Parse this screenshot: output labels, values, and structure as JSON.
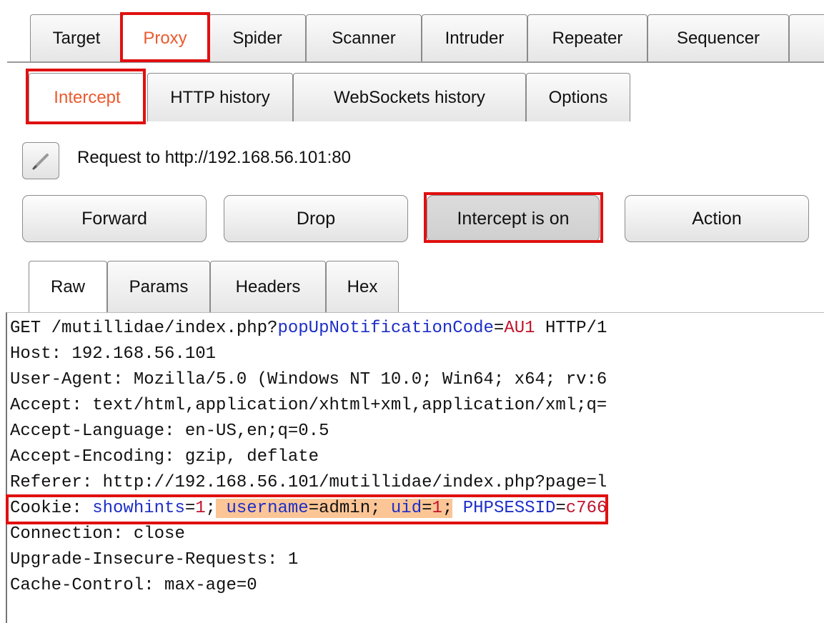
{
  "top_tabs": [
    "Target",
    "Proxy",
    "Spider",
    "Scanner",
    "Intruder",
    "Repeater",
    "Sequencer"
  ],
  "active_top_tab": "Proxy",
  "sub_tabs": [
    "Intercept",
    "HTTP history",
    "WebSockets history",
    "Options"
  ],
  "active_sub_tab": "Intercept",
  "request": {
    "icon": "pencil-icon",
    "label": "Request to http://192.168.56.101:80"
  },
  "buttons": {
    "forward": "Forward",
    "drop": "Drop",
    "intercept": "Intercept is on",
    "action": "Action"
  },
  "view_tabs": [
    "Raw",
    "Params",
    "Headers",
    "Hex"
  ],
  "active_view_tab": "Raw",
  "raw": {
    "line1": {
      "pre": "GET /mutillidae/index.php?",
      "param_name": "popUpNotificationCode",
      "eq": "=",
      "param_value": "AU1",
      "post": " HTTP/1"
    },
    "line2": "Host: 192.168.56.101",
    "line3": "User-Agent: Mozilla/5.0 (Windows NT 10.0; Win64; x64; rv:6",
    "line4": "Accept: text/html,application/xhtml+xml,application/xml;q=",
    "line5": "Accept-Language: en-US,en;q=0.5",
    "line6": "Accept-Encoding: gzip, deflate",
    "line7": "Referer: http://192.168.56.101/mutillidae/index.php?page=l",
    "cookie": {
      "key": "Cookie: ",
      "c1_name": "showhints",
      "c1_eq": "=",
      "c1_value": "1",
      "c1_sep": ";",
      "c2_lead": " ",
      "c2_name": "username",
      "c2_eq": "=admin; ",
      "c3_name": "uid",
      "c3_eq": "=",
      "c3_value": "1",
      "c3_sep": ";",
      "c4_lead": " ",
      "c4_name": "PHPSESSID",
      "c4_eq": "=",
      "c4_value": "c766"
    },
    "line9": "Connection: close",
    "line10": "Upgrade-Insecure-Requests: 1",
    "line11": "Cache-Control: max-age=0"
  },
  "colors": {
    "highlight_box": "#e01010",
    "active_tab_text": "#ea5a2e",
    "param_name": "#1d2fc7",
    "param_value": "#c0142c",
    "cookie_highlight": "#fbc596"
  }
}
